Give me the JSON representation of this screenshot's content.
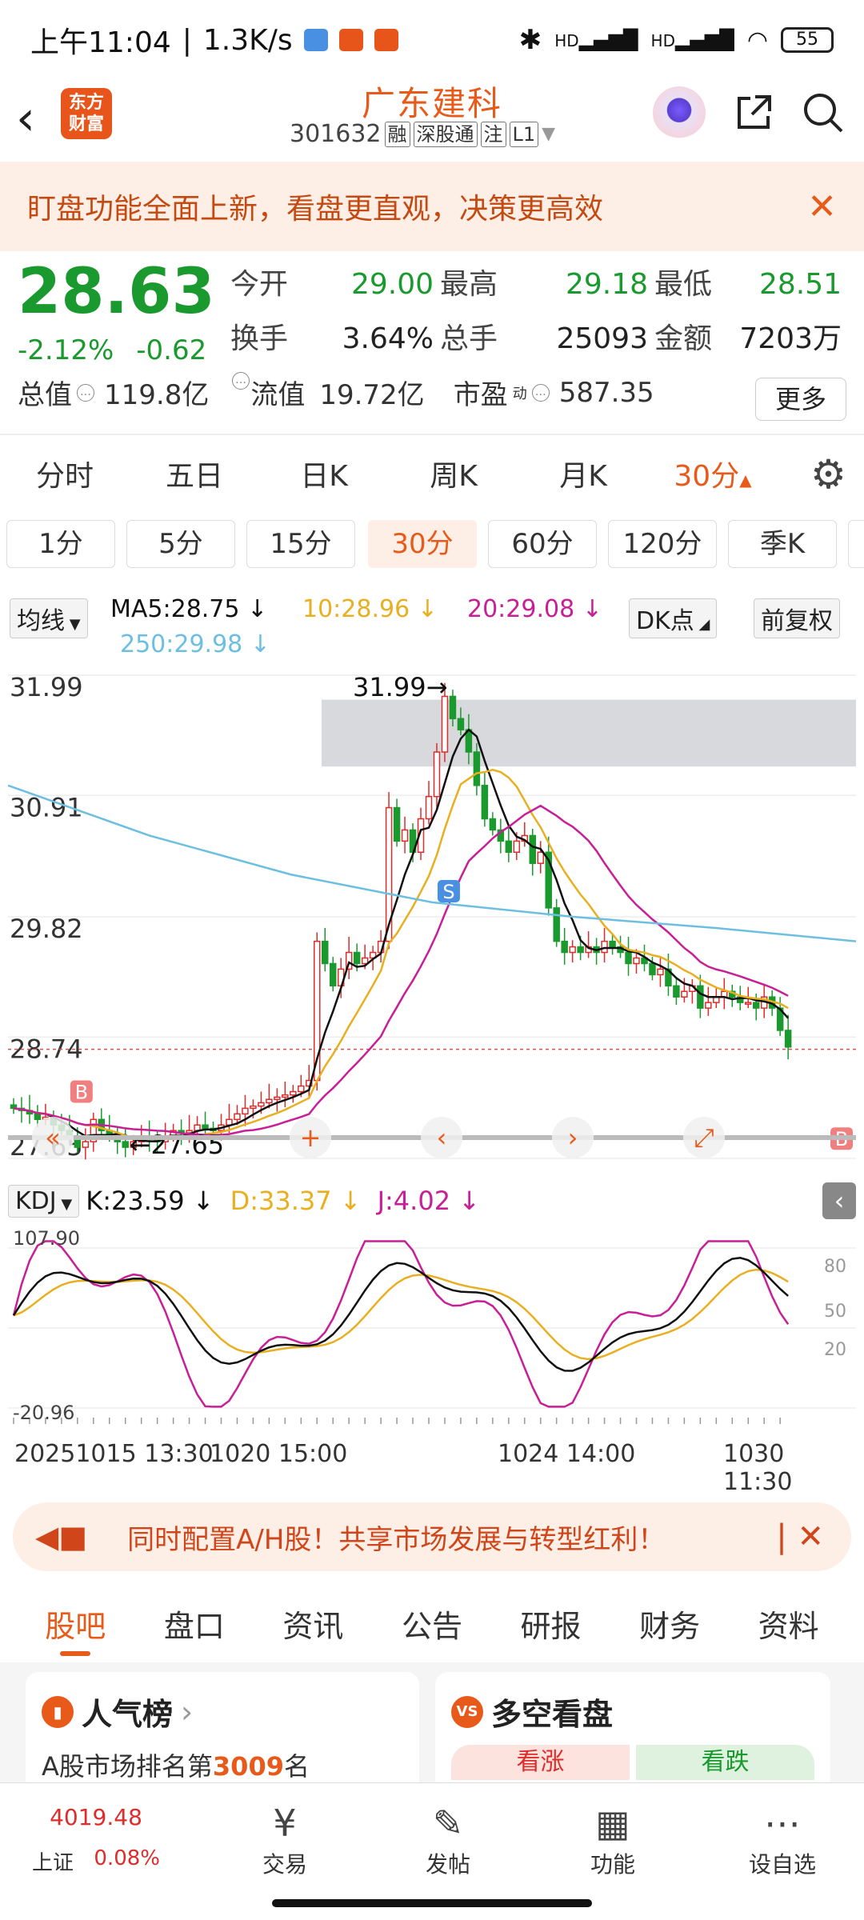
{
  "status": {
    "time": "上午11:04",
    "speed": "1.3K/s",
    "battery": "55",
    "hd1": "HD",
    "hd2": "HD"
  },
  "header": {
    "logo": "东方财富",
    "stock_name": "广东建科",
    "code": "301632",
    "tags": [
      "融",
      "深股通",
      "注",
      "L1"
    ]
  },
  "banner": {
    "text": "盯盘功能全面上新，看盘更直观，决策更高效"
  },
  "quote": {
    "price": "28.63",
    "change_pct": "-2.12%",
    "change": "-0.62",
    "open_label": "今开",
    "open": "29.00",
    "high_label": "最高",
    "high": "29.18",
    "low_label": "最低",
    "low": "28.51",
    "turnover_label": "换手",
    "turnover": "3.64%",
    "volume_label": "总手",
    "volume": "25093",
    "amount_label": "金额",
    "amount": "7203万",
    "mktcap_label": "总值",
    "mktcap": "119.8亿",
    "float_label": "流值",
    "float_cap": "19.72亿",
    "pe_label": "市盈",
    "pe_sup": "动",
    "pe": "587.35",
    "more": "更多"
  },
  "period_tabs": [
    "分时",
    "五日",
    "日K",
    "周K",
    "月K",
    "30分"
  ],
  "minute_tabs": [
    "1分",
    "5分",
    "15分",
    "30分",
    "60分",
    "120分",
    "季K"
  ],
  "ma": {
    "selector": "均线",
    "ma5": "MA5:28.75",
    "ma10": "10:28.96",
    "ma20": "20:29.08",
    "ma250": "250:29.98",
    "dk": "DK点",
    "fq": "前复权"
  },
  "colors": {
    "ma5": "#111111",
    "ma10": "#e8b020",
    "ma20": "#c81e96",
    "ma250": "#6cbfe0",
    "up": "#e02b2b",
    "down": "#1a9a2e",
    "accent": "#e85a1a"
  },
  "chart_data": {
    "type": "candlestick",
    "y_ticks": [
      "31.99",
      "30.91",
      "29.82",
      "28.74",
      "27.65"
    ],
    "ylim": [
      27.65,
      31.99
    ],
    "high_label": "31.99",
    "low_label": "27.65",
    "current_price": 28.63,
    "ma250": [
      31.0,
      30.55,
      30.2,
      29.95,
      29.82,
      29.72,
      29.6
    ],
    "markers": [
      "B",
      "S",
      "B"
    ]
  },
  "kdj": {
    "selector": "KDJ",
    "k": "K:23.59",
    "d": "D:33.37",
    "j": "J:4.02",
    "y_top": "107.90",
    "y_bottom": "-20.96",
    "levels": [
      "80",
      "50",
      "20"
    ]
  },
  "x_axis": {
    "t1": "20251015 13:30",
    "t2": "1020 15:00",
    "t3": "1024 14:00",
    "t4": "1030 11:30"
  },
  "ad": {
    "text": "同时配置A/H股！共享市场发展与转型红利！"
  },
  "bottom_tabs": [
    "股吧",
    "盘口",
    "资讯",
    "公告",
    "研报",
    "财务",
    "资料"
  ],
  "cards": {
    "popularity_title": "人气榜",
    "popularity_rank_prefix": "A股市场排名第",
    "popularity_rank": "3009",
    "popularity_rank_suffix": "名",
    "bull_title": "多空看盘",
    "bull_up": "看涨",
    "bull_down": "看跌"
  },
  "nav": {
    "index_value": "4019.48",
    "index_name": "上证",
    "index_chg": "0.08%",
    "trade": "交易",
    "post": "发帖",
    "func": "功能",
    "watch": "设自选"
  }
}
